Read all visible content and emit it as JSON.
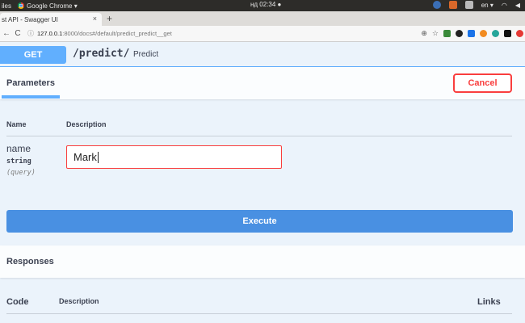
{
  "os_bar": {
    "files_label": "iles",
    "app_label": "Google Chrome ▾",
    "clock": "нд 02:34 ●",
    "lang": "en ▾"
  },
  "browser": {
    "tab_title": "st API - Swagger UI",
    "tab_close": "×",
    "new_tab": "+",
    "back_icon": "←",
    "reload_icon": "C",
    "info_icon": "ⓘ",
    "url_host": "127.0.0.1",
    "url_rest": ":8000/docs#/default/predict_predict__get",
    "zoom_icon": "⊕",
    "star_icon": "☆"
  },
  "operation": {
    "method": "GET",
    "path": "/predict/",
    "summary": "Predict"
  },
  "parameters": {
    "tab_label": "Parameters",
    "cancel_label": "Cancel",
    "col_name": "Name",
    "col_description": "Description",
    "items": [
      {
        "name": "name",
        "type": "string",
        "in": "(query)",
        "value": "Mark"
      }
    ]
  },
  "execute_label": "Execute",
  "responses": {
    "title": "Responses",
    "col_code": "Code",
    "col_description": "Description",
    "col_links": "Links"
  },
  "colors": {
    "get_blue": "#61affe",
    "execute_blue": "#4990e2",
    "cancel_red": "#f93e3e",
    "bg_light": "#ebf3fb"
  }
}
